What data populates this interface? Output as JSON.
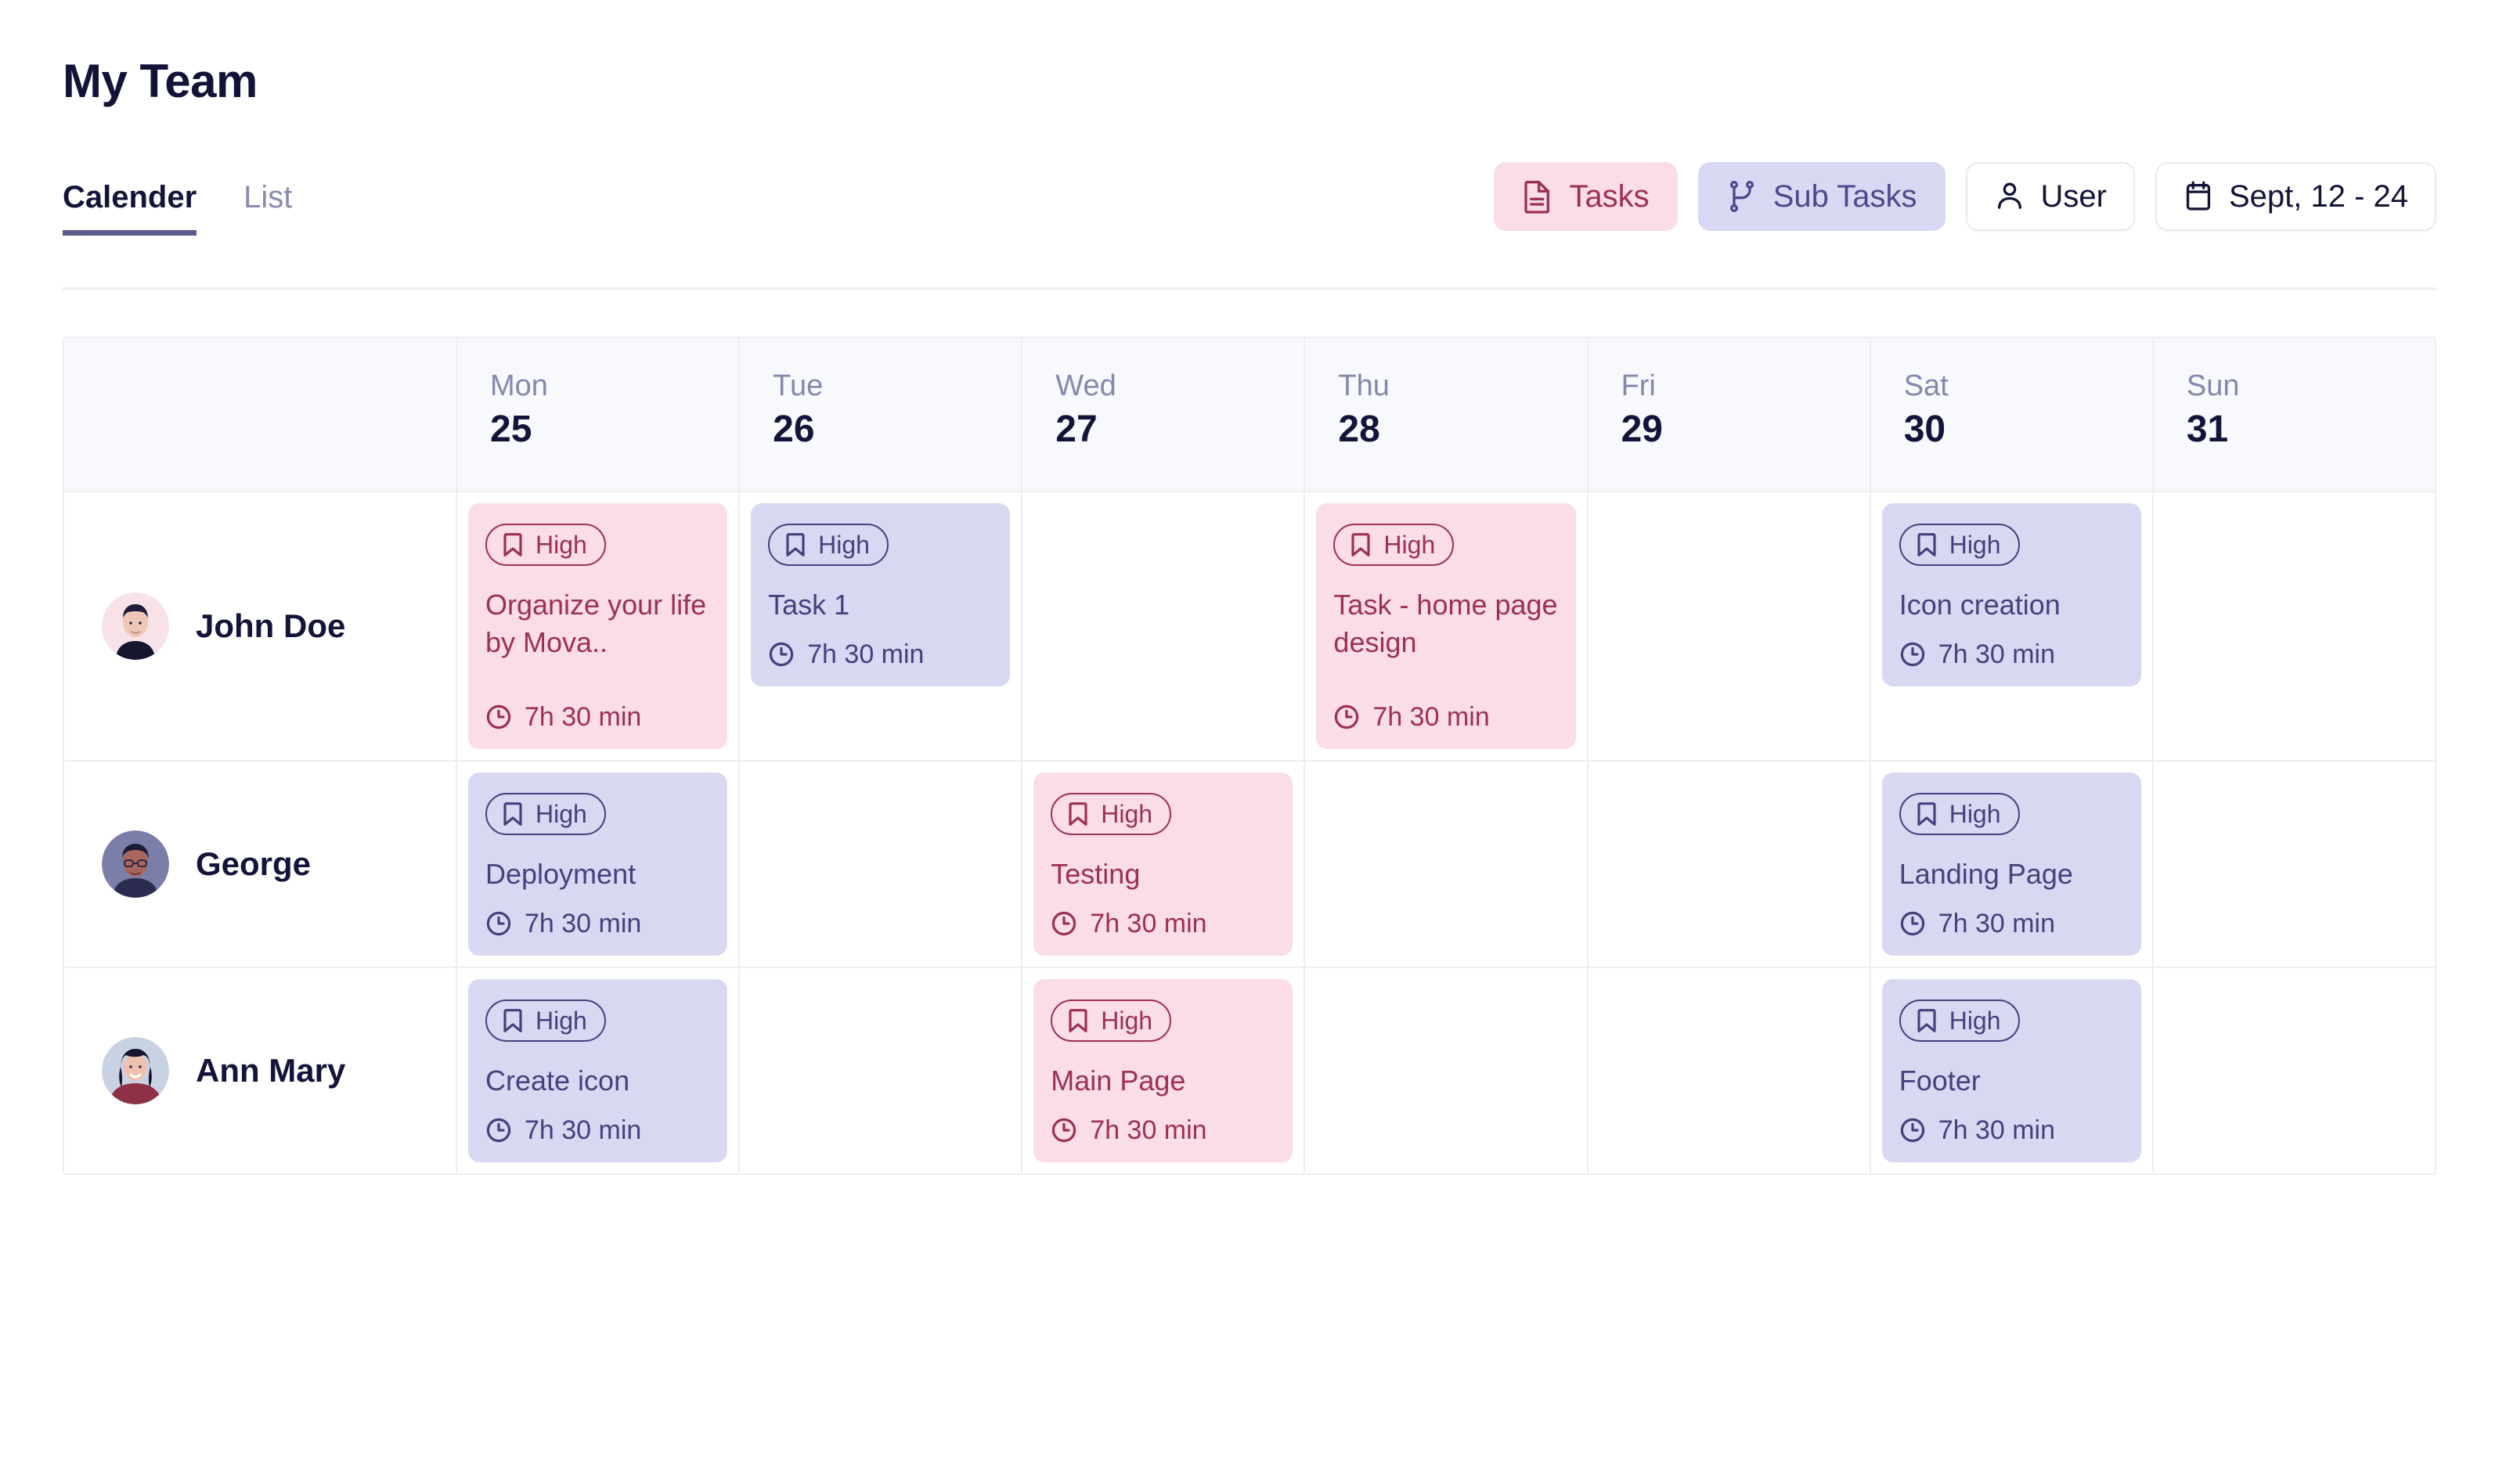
{
  "header": {
    "title": "My Team"
  },
  "tabs": [
    {
      "label": "Calender",
      "active": true
    },
    {
      "label": "List",
      "active": false
    }
  ],
  "toolbar": [
    {
      "label": "Tasks",
      "icon": "document-icon",
      "style": "tasks"
    },
    {
      "label": "Sub Tasks",
      "icon": "git-branch-icon",
      "style": "subtasks"
    },
    {
      "label": "User",
      "icon": "user-icon",
      "style": "plain"
    },
    {
      "label": "Sept, 12 - 24",
      "icon": "calendar-icon",
      "style": "plain"
    }
  ],
  "calendar": {
    "columns": [
      {
        "dow": "Mon",
        "date": "25"
      },
      {
        "dow": "Tue",
        "date": "26"
      },
      {
        "dow": "Wed",
        "date": "27"
      },
      {
        "dow": "Thu",
        "date": "28"
      },
      {
        "dow": "Fri",
        "date": "29"
      },
      {
        "dow": "Sat",
        "date": "30"
      },
      {
        "dow": "Sun",
        "31": "",
        "date": "31"
      }
    ],
    "rows": [
      {
        "person": "John Doe",
        "avatar": "avatar-john-doe",
        "cells": [
          {
            "task": {
              "priority": "High",
              "title": "Organize your life by Mova..",
              "duration": "7h 30 min",
              "color": "pink",
              "tall": true
            }
          },
          {
            "task": {
              "priority": "High",
              "title": "Task 1",
              "duration": "7h 30 min",
              "color": "purple",
              "tall": false
            }
          },
          {
            "task": null
          },
          {
            "task": {
              "priority": "High",
              "title": "Task - home page design",
              "duration": "7h 30 min",
              "color": "pink",
              "tall": true
            }
          },
          {
            "task": null
          },
          {
            "task": {
              "priority": "High",
              "title": "Icon creation",
              "duration": "7h 30 min",
              "color": "purple",
              "tall": false
            }
          },
          {
            "task": null
          }
        ]
      },
      {
        "person": "George",
        "avatar": "avatar-george",
        "cells": [
          {
            "task": {
              "priority": "High",
              "title": "Deployment",
              "duration": "7h 30 min",
              "color": "purple",
              "tall": false
            }
          },
          {
            "task": null
          },
          {
            "task": {
              "priority": "High",
              "title": "Testing",
              "duration": "7h 30 min",
              "color": "pink",
              "tall": false
            }
          },
          {
            "task": null
          },
          {
            "task": null
          },
          {
            "task": {
              "priority": "High",
              "title": "Landing Page",
              "duration": "7h 30 min",
              "color": "purple",
              "tall": false
            }
          },
          {
            "task": null
          }
        ]
      },
      {
        "person": "Ann Mary",
        "avatar": "avatar-ann-mary",
        "cells": [
          {
            "task": {
              "priority": "High",
              "title": "Create icon",
              "duration": "7h 30 min",
              "color": "purple",
              "tall": false
            }
          },
          {
            "task": null
          },
          {
            "task": {
              "priority": "High",
              "title": "Main Page",
              "duration": "7h 30 min",
              "color": "pink",
              "tall": false
            }
          },
          {
            "task": null
          },
          {
            "task": null
          },
          {
            "task": {
              "priority": "High",
              "title": "Footer",
              "duration": "7h 30 min",
              "color": "purple",
              "tall": false
            }
          },
          {
            "task": null
          }
        ]
      }
    ]
  },
  "colors": {
    "pink_bg": "#fadde6",
    "pink_fg": "#9c3055",
    "purple_bg": "#d8d8f2",
    "purple_fg": "#42427e",
    "ink": "#14143a",
    "muted": "#8787ad",
    "grid_line": "#edeef2",
    "header_bg": "#f8f9fc"
  }
}
